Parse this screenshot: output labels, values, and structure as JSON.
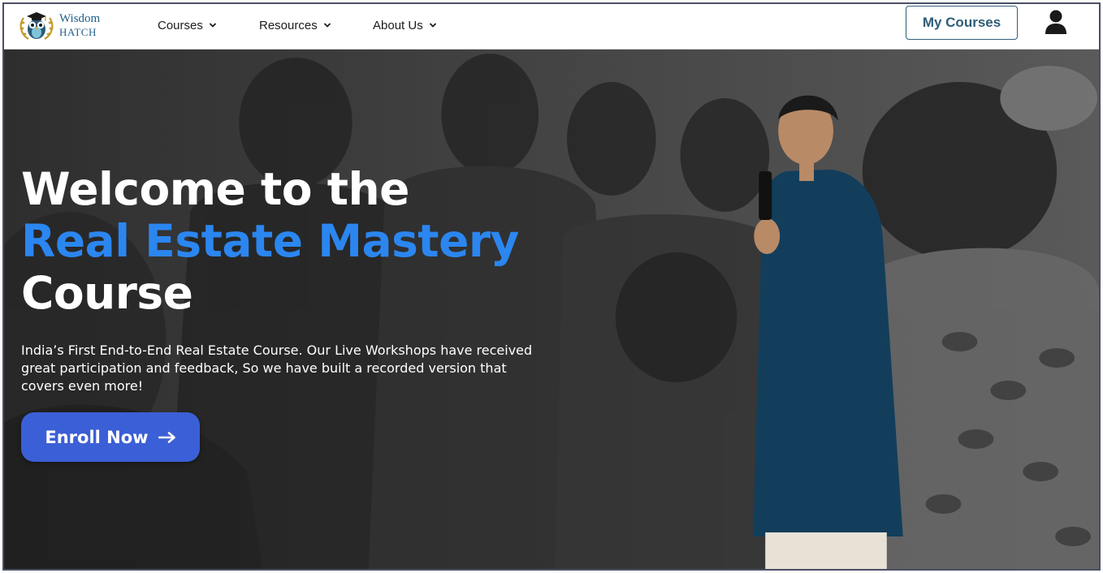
{
  "brand": {
    "name_line1": "Wisdom",
    "name_line2": "HATCH",
    "color": "#1f5f8b"
  },
  "nav": {
    "items": [
      {
        "label": "Courses",
        "icon": "chevron-down-icon"
      },
      {
        "label": "Resources",
        "icon": "chevron-down-icon"
      },
      {
        "label": "About Us",
        "icon": "chevron-down-icon"
      }
    ],
    "my_courses_label": "My Courses",
    "user_icon": "user-icon"
  },
  "hero": {
    "title_line1": "Welcome to the",
    "title_accent": "Real Estate Mastery",
    "title_line3": "Course",
    "description": "India’s First End-to-End Real Estate Course. Our Live Workshops have received great participation and feedback, So we have built a recorded version that covers even more!",
    "cta_label": "Enroll Now",
    "cta_icon": "arrow-right-icon"
  },
  "colors": {
    "accent_blue": "#2b86f0",
    "cta_blue": "#3b5fd6",
    "button_border": "#2f5d77",
    "hero_overlay": "#3b3b3b"
  }
}
